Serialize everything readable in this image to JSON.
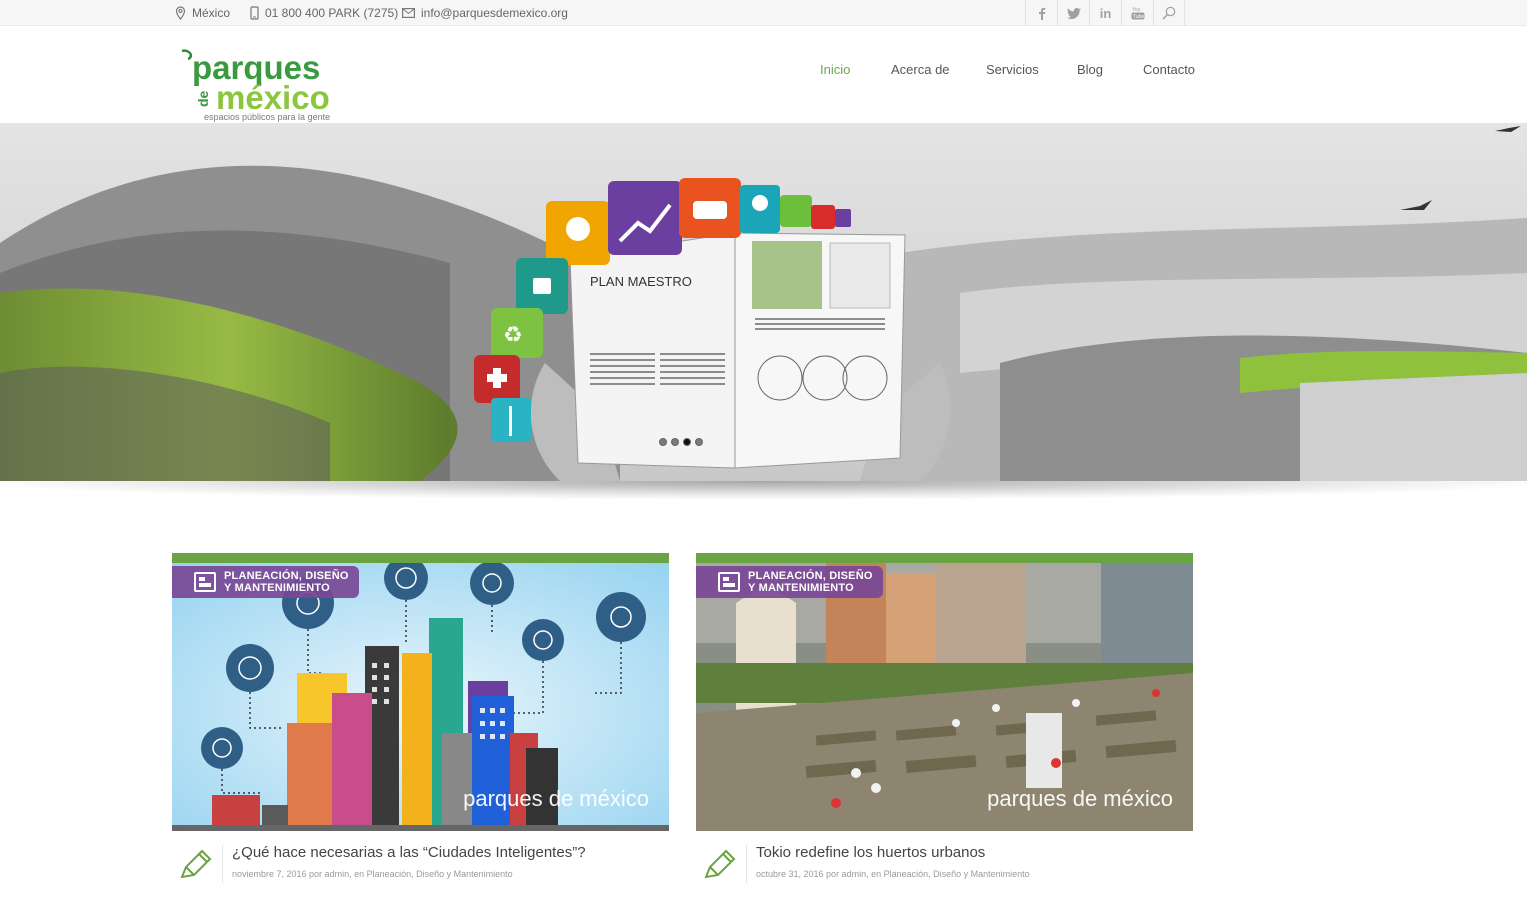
{
  "topbar": {
    "location": "México",
    "phone": "01 800 400 PARK (7275)",
    "email": "info@parquesdemexico.org",
    "social": [
      "facebook-icon",
      "twitter-icon",
      "linkedin-icon",
      "youtube-icon",
      "search-icon"
    ]
  },
  "logo": {
    "line1": "parques",
    "de": "de",
    "line2": "méxico",
    "tagline": "espacios públicos para la gente"
  },
  "nav": {
    "items": [
      {
        "label": "Inicio",
        "active": true
      },
      {
        "label": "Acerca de",
        "active": false
      },
      {
        "label": "Servicios",
        "active": false
      },
      {
        "label": "Blog",
        "active": false
      },
      {
        "label": "Contacto",
        "active": false
      }
    ]
  },
  "hero": {
    "book_title": "PLAN MAESTRO",
    "slides": 4,
    "active_slide": 3
  },
  "posts": [
    {
      "category_line1": "PLANEACIÓN, DISEÑO",
      "category_line2": "Y MANTENIMIENTO",
      "title": "¿Qué hace necesarias a las “Ciudades Inteligentes”?",
      "meta": "noviembre 7, 2016 por admin, en Planeación, Diseño y Mantenimiento",
      "watermark": "parques de méxico"
    },
    {
      "category_line1": "PLANEACIÓN, DISEÑO",
      "category_line2": "Y MANTENIMIENTO",
      "title": "Tokio redefine los huertos urbanos",
      "meta": "octubre 31, 2016 por admin, en Planeación, Diseño y Mantenimiento",
      "watermark": "parques de méxico"
    }
  ],
  "colors": {
    "brand_green": "#6aa341",
    "nav_active": "#6aa84f",
    "category_purple": "#784896"
  }
}
